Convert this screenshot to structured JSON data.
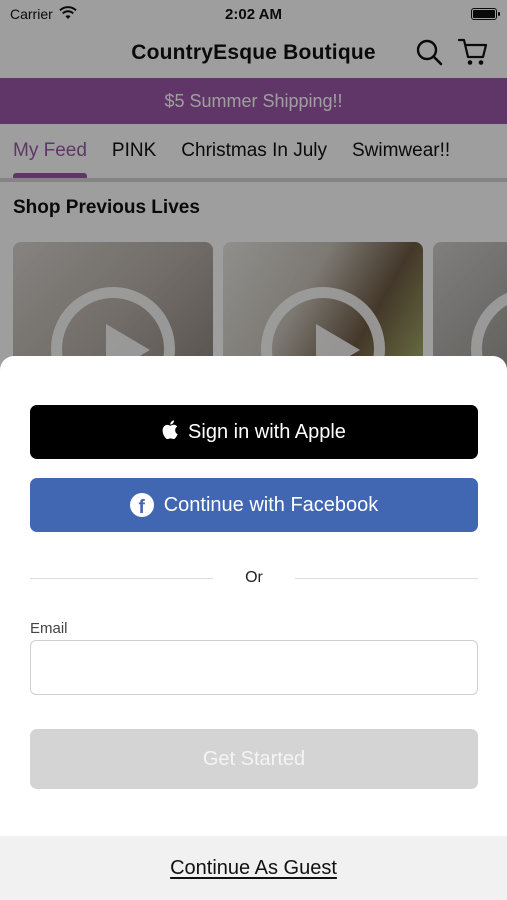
{
  "status_bar": {
    "carrier": "Carrier",
    "time": "2:02 AM"
  },
  "header": {
    "title": "CountryEsque Boutique"
  },
  "promo": {
    "text": "$5 Summer Shipping!!"
  },
  "tabs": [
    {
      "label": "My Feed",
      "active": true
    },
    {
      "label": "PINK",
      "active": false
    },
    {
      "label": "Christmas In July",
      "active": false
    },
    {
      "label": "Swimwear!!",
      "active": false
    }
  ],
  "section": {
    "title": "Shop Previous Lives"
  },
  "sheet": {
    "apple_label": "Sign in with Apple",
    "facebook_label": "Continue with Facebook",
    "divider_text": "Or",
    "email_label": "Email",
    "email_value": "",
    "get_started_label": "Get Started",
    "guest_label": "Continue As Guest"
  },
  "colors": {
    "accent": "#9c57a8",
    "facebook": "#4267b2",
    "apple": "#000000",
    "disabled_button": "#d4d4d4"
  },
  "icons": [
    "wifi-icon",
    "battery-icon",
    "search-icon",
    "cart-icon",
    "play-icon",
    "apple-icon",
    "facebook-icon"
  ]
}
